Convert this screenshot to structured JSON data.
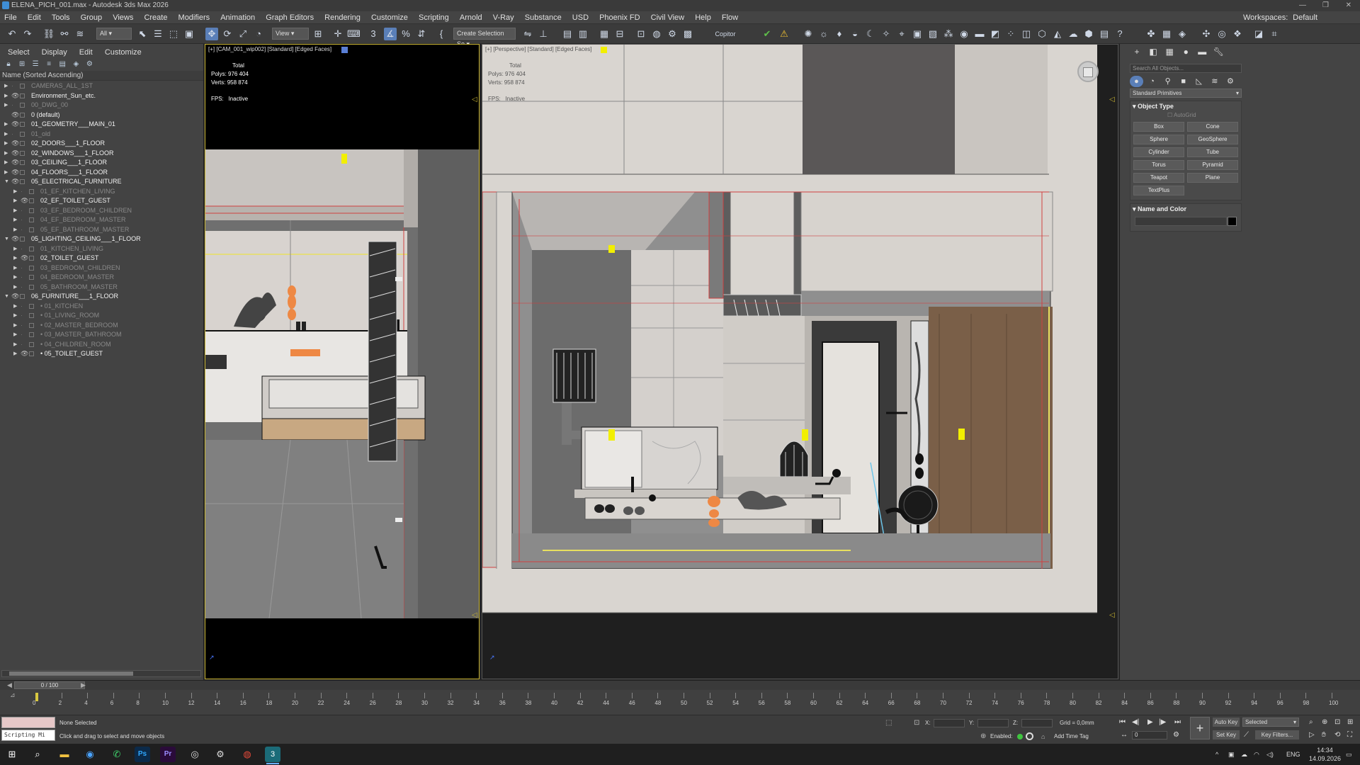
{
  "window": {
    "title": "ELENA_PICH_001.max - Autodesk 3ds Max 2026",
    "workspace_label": "Workspaces:",
    "workspace_value": "Default"
  },
  "menu": [
    "File",
    "Edit",
    "Tools",
    "Group",
    "Views",
    "Create",
    "Modifiers",
    "Animation",
    "Graph Editors",
    "Rendering",
    "Customize",
    "Scripting",
    "Arnold",
    "V-Ray",
    "Substance",
    "USD",
    "Phoenix FD",
    "Civil View",
    "Help",
    "Flow"
  ],
  "toolbar": {
    "selection_filter": "All",
    "ref_coord": "View",
    "named_selection": "Create Selection Se",
    "copitor": "Copitor"
  },
  "scene_explorer": {
    "tabs": [
      "Select",
      "Display",
      "Edit",
      "Customize"
    ],
    "header": "Name (Sorted Ascending)",
    "rows": [
      {
        "label": "CAMERAS_ALL_1ST",
        "level": 0,
        "tri": "▶",
        "eye": false,
        "style": "dim"
      },
      {
        "label": "Environment_Sun_etc.",
        "level": 0,
        "tri": "▶",
        "eye": true,
        "style": "bright"
      },
      {
        "label": "00_DWG_00",
        "level": 0,
        "tri": "▶",
        "eye": false,
        "style": "dim"
      },
      {
        "label": "0 (default)",
        "level": 0,
        "tri": "",
        "eye": true,
        "style": "bright"
      },
      {
        "label": "01_GEOMETRY___MAIN_01",
        "level": 0,
        "tri": "▶",
        "eye": true,
        "style": "bright"
      },
      {
        "label": "01_old",
        "level": 0,
        "tri": "▶",
        "eye": false,
        "style": "dim"
      },
      {
        "label": "02_DOORS___1_FLOOR",
        "level": 0,
        "tri": "▶",
        "eye": true,
        "style": "bright"
      },
      {
        "label": "02_WINDOWS___1_FLOOR",
        "level": 0,
        "tri": "▶",
        "eye": true,
        "style": "bright"
      },
      {
        "label": "03_CEILING___1_FLOOR",
        "level": 0,
        "tri": "▶",
        "eye": true,
        "style": "bright"
      },
      {
        "label": "04_FLOORS___1_FLOOR",
        "level": 0,
        "tri": "▶",
        "eye": true,
        "style": "bright"
      },
      {
        "label": "05_ELECTRICAL_FURNITURE",
        "level": 0,
        "tri": "▼",
        "eye": true,
        "style": "bright"
      },
      {
        "label": "01_EF_KITCHEN_LIVING",
        "level": 1,
        "tri": "▶",
        "eye": false,
        "style": "dim"
      },
      {
        "label": "02_EF_TOILET_GUEST",
        "level": 1,
        "tri": "▶",
        "eye": true,
        "style": "bright"
      },
      {
        "label": "03_EF_BEDROOM_CHILDREN",
        "level": 1,
        "tri": "▶",
        "eye": false,
        "style": "dim"
      },
      {
        "label": "04_EF_BEDROOM_MASTER",
        "level": 1,
        "tri": "▶",
        "eye": false,
        "style": "dim"
      },
      {
        "label": "05_EF_BATHROOM_MASTER",
        "level": 1,
        "tri": "▶",
        "eye": false,
        "style": "dim"
      },
      {
        "label": "05_LIGHTING_CEILING___1_FLOOR",
        "level": 0,
        "tri": "▼",
        "eye": true,
        "style": "bright"
      },
      {
        "label": "01_KITCHEN_LIVING",
        "level": 1,
        "tri": "▶",
        "eye": false,
        "style": "dim"
      },
      {
        "label": "02_TOILET_GUEST",
        "level": 1,
        "tri": "▶",
        "eye": true,
        "style": "bright"
      },
      {
        "label": "03_BEDROOM_CHILDREN",
        "level": 1,
        "tri": "▶",
        "eye": false,
        "style": "dim"
      },
      {
        "label": "04_BEDROOM_MASTER",
        "level": 1,
        "tri": "▶",
        "eye": false,
        "style": "dim"
      },
      {
        "label": "05_BATHROOM_MASTER",
        "level": 1,
        "tri": "▶",
        "eye": false,
        "style": "dim"
      },
      {
        "label": "06_FURNITURE___1_FLOOR",
        "level": 0,
        "tri": "▼",
        "eye": true,
        "style": "bright"
      },
      {
        "label": "• 01_KITCHEN",
        "level": 1,
        "tri": "▶",
        "eye": false,
        "style": "dim"
      },
      {
        "label": "• 01_LIVING_ROOM",
        "level": 1,
        "tri": "▶",
        "eye": false,
        "style": "dim"
      },
      {
        "label": "• 02_MASTER_BEDROOM",
        "level": 1,
        "tri": "▶",
        "eye": false,
        "style": "dim"
      },
      {
        "label": "• 03_MASTER_BATHROOM",
        "level": 1,
        "tri": "▶",
        "eye": false,
        "style": "dim"
      },
      {
        "label": "• 04_CHILDREN_ROOM",
        "level": 1,
        "tri": "▶",
        "eye": false,
        "style": "dim"
      },
      {
        "label": "• 05_TOILET_GUEST",
        "level": 1,
        "tri": "▶",
        "eye": true,
        "style": "bright"
      }
    ]
  },
  "viewport_left": {
    "label": "[+] [CAM_001_wip002] [Standard] [Edged Faces]",
    "stats_total": "Total",
    "polys_label": "Polys:",
    "polys_value": "976 404",
    "verts_label": "Verts:",
    "verts_value": "958 874",
    "fps_label": "FPS:",
    "fps_value": "Inactive"
  },
  "viewport_right": {
    "label": "[+] [Perspective] [Standard] [Edged Faces]",
    "stats_total": "Total",
    "polys_label": "Polys:",
    "polys_value": "976 404",
    "verts_label": "Verts:",
    "verts_value": "958 874",
    "fps_label": "FPS:",
    "fps_value": "Inactive"
  },
  "command_panel": {
    "search_placeholder": "Search All Objects...",
    "category": "Standard Primitives",
    "object_type_title": "Object Type",
    "autogrid": "AutoGrid",
    "primitives": [
      "Box",
      "Cone",
      "Sphere",
      "GeoSphere",
      "Cylinder",
      "Tube",
      "Torus",
      "Pyramid",
      "Teapot",
      "Plane",
      "TextPlus"
    ],
    "name_color_title": "Name and Color"
  },
  "timeline": {
    "frame_counter": "0 / 100",
    "ticks": [
      "0",
      "2",
      "4",
      "6",
      "8",
      "10",
      "12",
      "14",
      "16",
      "18",
      "20",
      "22",
      "24",
      "26",
      "28",
      "30",
      "32",
      "34",
      "36",
      "38",
      "40",
      "42",
      "44",
      "46",
      "48",
      "50",
      "52",
      "54",
      "56",
      "58",
      "60",
      "62",
      "64",
      "66",
      "68",
      "70",
      "72",
      "74",
      "76",
      "78",
      "80",
      "82",
      "84",
      "86",
      "88",
      "90",
      "92",
      "94",
      "96",
      "98",
      "100"
    ]
  },
  "status": {
    "script_label": "Scripting Mi",
    "selection": "None Selected",
    "hint": "Click and drag to select and move objects",
    "x_label": "X:",
    "y_label": "Y:",
    "z_label": "Z:",
    "grid": "Grid = 0,0mm",
    "enabled": "Enabled:",
    "add_time_tag": "Add Time Tag",
    "auto_key": "Auto Key",
    "set_key": "Set Key",
    "key_mode": "Selected",
    "key_filters": "Key Filters...",
    "frame_field": "0"
  },
  "taskbar": {
    "lang": "ENG",
    "time": "14:34",
    "date": "14.09.2026"
  },
  "colors": {
    "accent": "#5a7fb8",
    "viewport_border_active": "#c9b532",
    "mesh_red": "#d04040",
    "highlight_yellow": "#f2ef00"
  }
}
